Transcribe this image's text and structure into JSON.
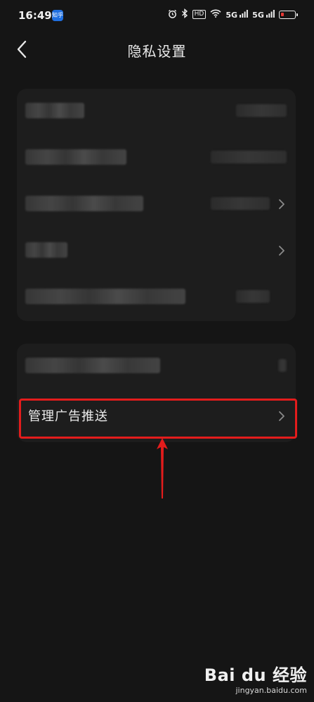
{
  "status_bar": {
    "time": "16:49",
    "app_badge": "知乎",
    "hd_label": "HD",
    "signal1_label": "5G",
    "signal2_label": "5G",
    "icons": [
      "alarm-icon",
      "bluetooth-icon",
      "hd-icon",
      "wifi-icon",
      "signal-icon",
      "signal-icon",
      "battery-icon"
    ]
  },
  "header": {
    "title": "隐私设置",
    "back_icon": "chevron-left-icon"
  },
  "settings_group_2": {
    "ad_item_label": "管理广告推送"
  },
  "colors": {
    "background": "#151515",
    "card": "#1d1d1d",
    "highlight": "#e31c1c",
    "battery_low": "#e53935"
  },
  "watermark": {
    "logo_text": "Bai du 经验",
    "url": "jingyan.baidu.com"
  }
}
